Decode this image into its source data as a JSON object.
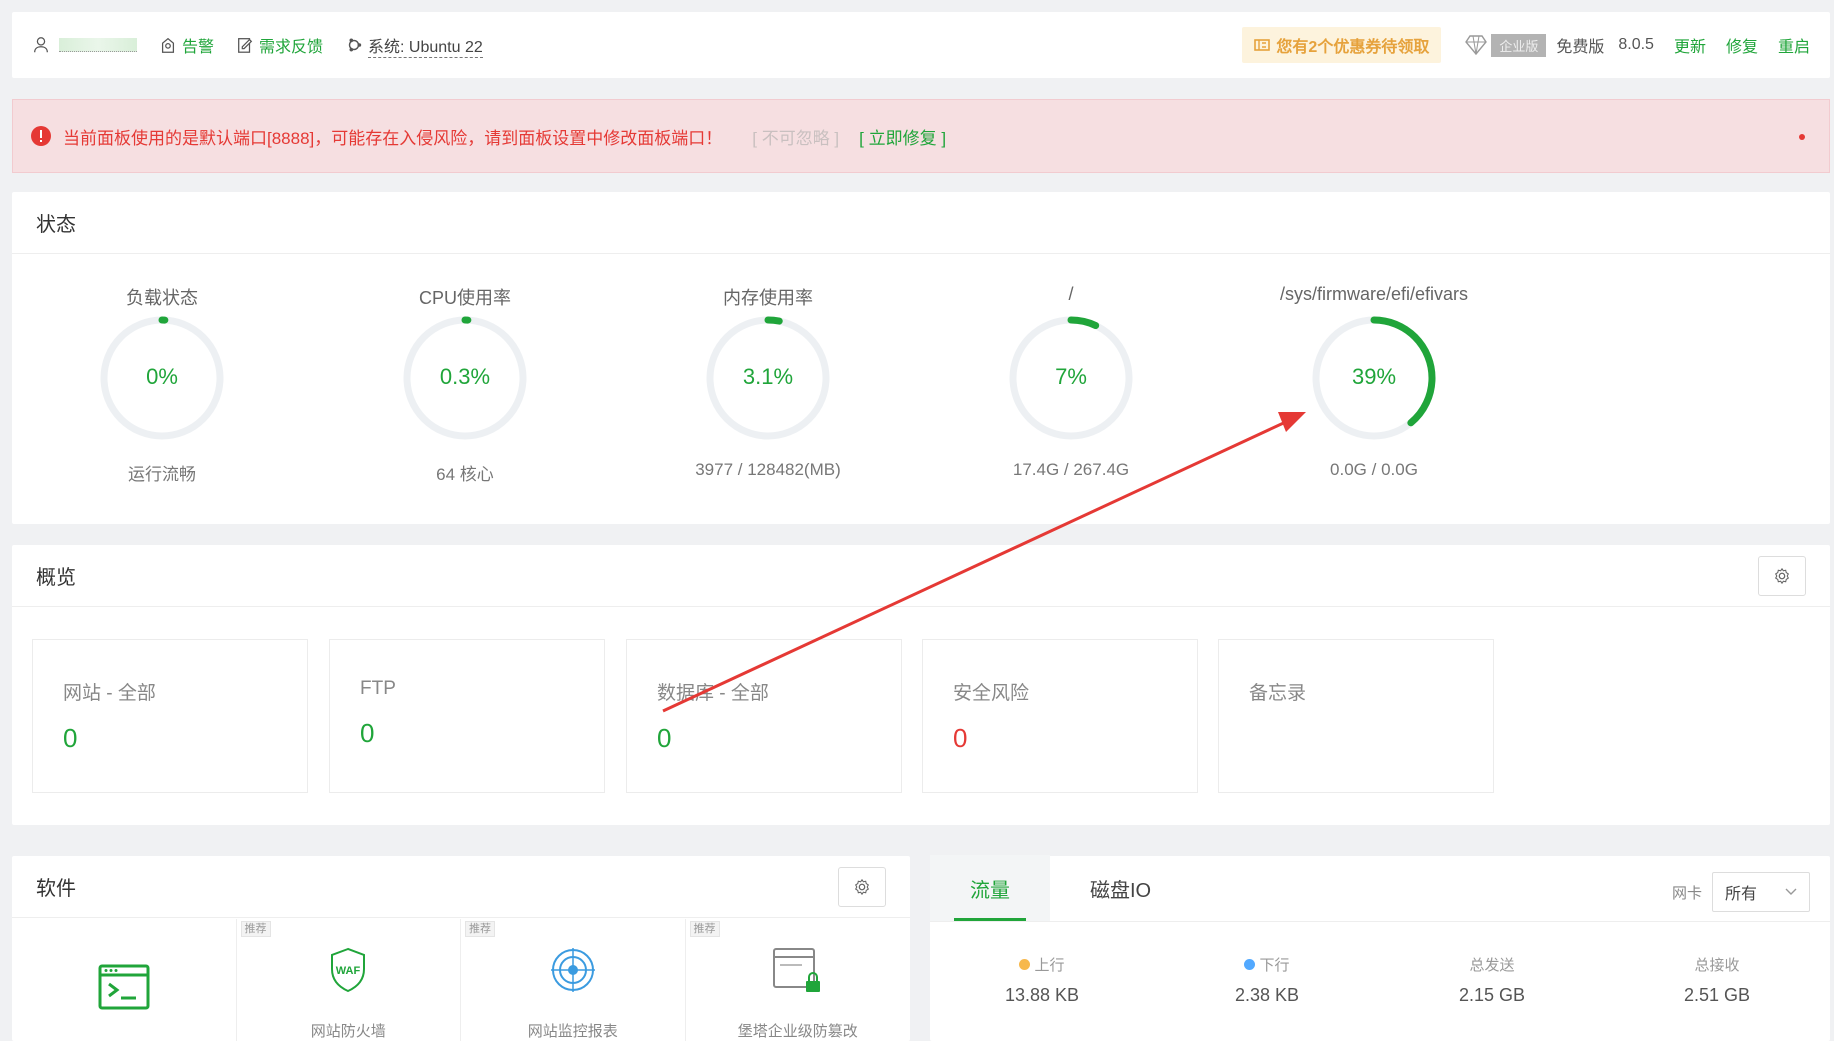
{
  "topbar": {
    "alarm_label": "告警",
    "feedback_label": "需求反馈",
    "system_label": "系统:  Ubuntu 22",
    "coupon_label": "您有2个优惠券待领取",
    "enterprise_label": "企业版",
    "edition_label": "免费版",
    "version": "8.0.5",
    "update_label": "更新",
    "repair_label": "修复",
    "restart_label": "重启"
  },
  "warning": {
    "message": "当前面板使用的是默认端口[8888]，可能存在入侵风险，请到面板设置中修改面板端口！",
    "ignore_label": "[ 不可忽略 ]",
    "fix_label": "[ 立即修复 ]"
  },
  "status": {
    "title": "状态",
    "gauges": [
      {
        "title": "负载状态",
        "value": "0%",
        "sub": "运行流畅",
        "percent": 0
      },
      {
        "title": "CPU使用率",
        "value": "0.3%",
        "sub": "64 核心",
        "percent": 0.3
      },
      {
        "title": "内存使用率",
        "value": "3.1%",
        "sub": "3977 / 128482(MB)",
        "percent": 3.1
      },
      {
        "title": "/",
        "value": "7%",
        "sub": "17.4G / 267.4G",
        "percent": 7
      },
      {
        "title": "/sys/firmware/efi/efivars",
        "value": "39%",
        "sub": "0.0G / 0.0G",
        "percent": 39
      }
    ]
  },
  "overview": {
    "title": "概览",
    "items": [
      {
        "label": "网站 - 全部",
        "value": "0"
      },
      {
        "label": "FTP",
        "value": "0"
      },
      {
        "label": "数据库 - 全部",
        "value": "0"
      },
      {
        "label": "安全风险",
        "value": "0"
      },
      {
        "label": "备忘录",
        "value": ""
      }
    ]
  },
  "software": {
    "title": "软件",
    "items": [
      {
        "name": "",
        "tag": ""
      },
      {
        "name": "网站防火墙",
        "tag": "推荐"
      },
      {
        "name": "网站监控报表",
        "tag": "推荐"
      },
      {
        "name": "堡塔企业级防篡改",
        "tag": "推荐"
      }
    ]
  },
  "traffic": {
    "tabs": [
      "流量",
      "磁盘IO"
    ],
    "nic_label": "网卡",
    "nic_value": "所有",
    "stats": [
      {
        "label": "上行",
        "value": "13.88 KB"
      },
      {
        "label": "下行",
        "value": "2.38 KB"
      },
      {
        "label": "总发送",
        "value": "2.15 GB"
      },
      {
        "label": "总接收",
        "value": "2.51 GB"
      }
    ]
  },
  "colors": {
    "brand_green": "#20a53a",
    "danger_red": "#e53935",
    "upload_dot": "#f7b84b",
    "download_dot": "#52a9ff",
    "annotation_arrow": "#e53935"
  }
}
